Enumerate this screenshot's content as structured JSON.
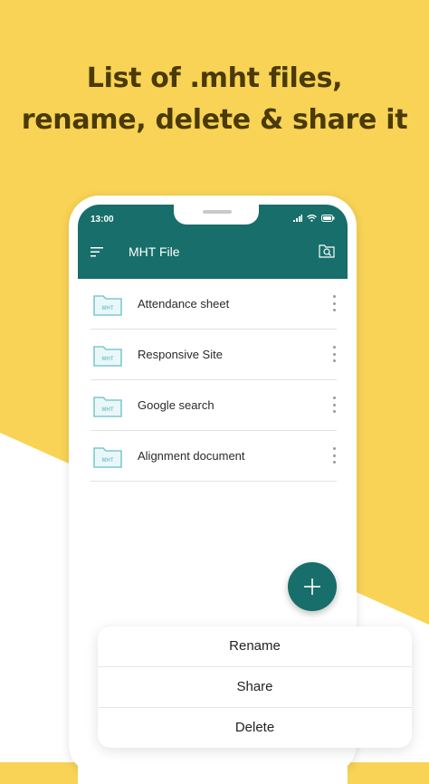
{
  "headline": {
    "line1": "List of .mht files,",
    "line2": "rename, delete & share it"
  },
  "status_bar": {
    "time": "13:00",
    "icons": [
      "signal-icon",
      "wifi-icon",
      "battery-icon"
    ]
  },
  "app_bar": {
    "title": "MHT File",
    "left_icon": "menu-icon",
    "right_icon": "folder-search-icon"
  },
  "files": [
    {
      "name": "Attendance sheet",
      "icon_label": "MHT"
    },
    {
      "name": "Responsive Site",
      "icon_label": "MHT"
    },
    {
      "name": "Google search",
      "icon_label": "MHT"
    },
    {
      "name": "Alignment document",
      "icon_label": "MHT"
    }
  ],
  "fab": {
    "icon": "plus-icon"
  },
  "context_menu": {
    "items": [
      "Rename",
      "Share",
      "Delete"
    ]
  },
  "colors": {
    "background_yellow": "#f8d355",
    "primary_teal": "#176e6a",
    "headline_text": "#4a3a08",
    "file_icon": "#7fc9d0"
  }
}
